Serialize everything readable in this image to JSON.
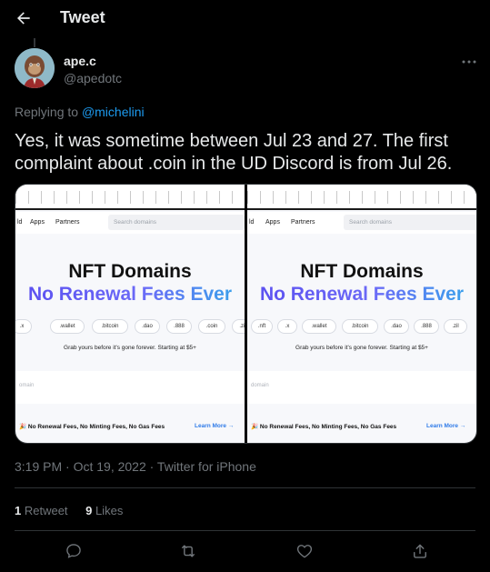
{
  "header": {
    "title": "Tweet"
  },
  "author": {
    "name": "ape.c",
    "handle": "@apedotc"
  },
  "replying": {
    "prefix": "Replying to ",
    "to": "@michelini"
  },
  "tweet": {
    "text": "Yes, it was sometime between Jul 23 and 27. The first complaint about .coin in the UD Discord is from Jul 26."
  },
  "media": {
    "left": {
      "nav": [
        "ld",
        "Apps",
        "Partners"
      ],
      "search_placeholder": "Search domains",
      "title": "NFT Domains",
      "subtitle": "No Renewal Fees Ever",
      "chips": [
        ".x",
        ".wallet",
        ".bitcoin",
        ".dao",
        ".888",
        ".coin",
        ".zil"
      ],
      "grab": "Grab yours before it's gone forever. Starting at $5+",
      "input_placeholder": "omain",
      "banner": "🎉 No Renewal Fees, No Minting Fees, No Gas Fees",
      "learn_more": "Learn More →"
    },
    "right": {
      "nav": [
        "ld",
        "Apps",
        "Partners"
      ],
      "search_placeholder": "Search domains",
      "title": "NFT Domains",
      "subtitle": "No Renewal Fees Ever",
      "chips": [
        ".nft",
        ".x",
        ".wallet",
        ".bitcoin",
        ".dao",
        ".888",
        ".zil"
      ],
      "grab": "Grab yours before it's gone forever. Starting at $5+",
      "input_placeholder": "domain",
      "banner": "🎉 No Renewal Fees, No Minting Fees, No Gas Fees",
      "learn_more": "Learn More →"
    }
  },
  "timestamp": "3:19 PM · Oct 19, 2022 · Twitter for iPhone",
  "stats": {
    "retweets_count": "1",
    "retweets_label": " Retweet",
    "likes_count": "9",
    "likes_label": " Likes"
  },
  "icons": {
    "back": "arrow-left-icon",
    "more": "ellipsis-icon",
    "reply": "reply-icon",
    "retweet": "retweet-icon",
    "like": "heart-icon",
    "share": "share-icon"
  },
  "colors": {
    "link": "#1d9bf0",
    "muted": "#71767b",
    "text": "#e7e9ea",
    "background": "#000000"
  }
}
